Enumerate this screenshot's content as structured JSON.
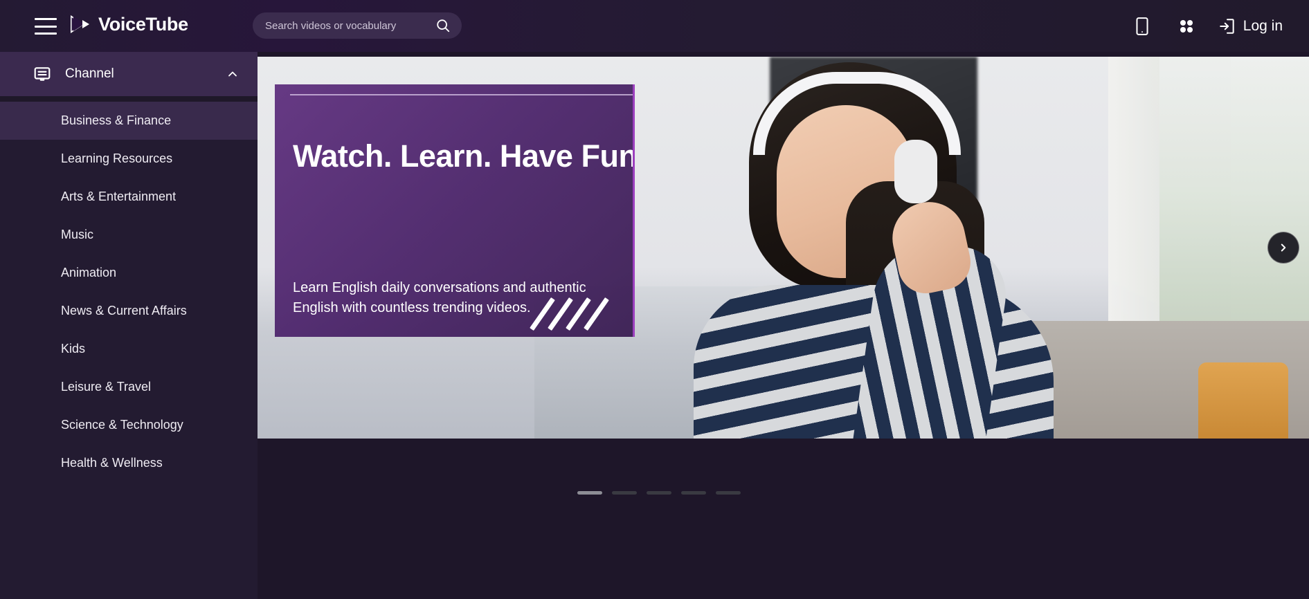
{
  "header": {
    "brand_name": "VoiceTube",
    "menu_icon": "hamburger-menu-icon",
    "logo_icon": "voicetube-play-logo",
    "search": {
      "placeholder": "Search videos or vocabulary",
      "value": "",
      "icon": "search-icon"
    },
    "mobile_app_icon": "mobile-phone-icon",
    "apps_grid_icon": "apps-grid-icon",
    "login_icon": "login-arrow-icon",
    "login_label": "Log in"
  },
  "sidebar": {
    "section": {
      "label": "Channel",
      "icon": "channel-board-icon",
      "chevron": "chevron-up-icon",
      "expanded": true
    },
    "items": [
      {
        "label": "Business & Finance",
        "active": true
      },
      {
        "label": "Learning Resources",
        "active": false
      },
      {
        "label": "Arts & Entertainment",
        "active": false
      },
      {
        "label": "Music",
        "active": false
      },
      {
        "label": "Animation",
        "active": false
      },
      {
        "label": "News & Current Affairs",
        "active": false
      },
      {
        "label": "Kids",
        "active": false
      },
      {
        "label": "Leisure & Travel",
        "active": false
      },
      {
        "label": "Science & Technology",
        "active": false
      },
      {
        "label": "Health & Wellness",
        "active": false
      }
    ]
  },
  "hero": {
    "title": "Watch. Learn. Have Fun!",
    "subtitle": "Learn English daily conversations and authentic English with countless trending videos.",
    "next_icon": "chevron-right-icon",
    "dots": [
      {
        "active": true
      },
      {
        "active": false
      },
      {
        "active": false
      },
      {
        "active": false
      },
      {
        "active": false
      }
    ]
  },
  "colors": {
    "brand_purple": "#3b2a4f",
    "sidebar_bg": "#231b31",
    "sidebar_active": "#392a4c",
    "header_bg": "#241a33",
    "page_bg": "#1e1629",
    "card_purple": "#5c2c7c",
    "card_border": "#9c3fbe",
    "dot_active": "#8d8d95",
    "dot_inactive": "#3a3a42"
  }
}
